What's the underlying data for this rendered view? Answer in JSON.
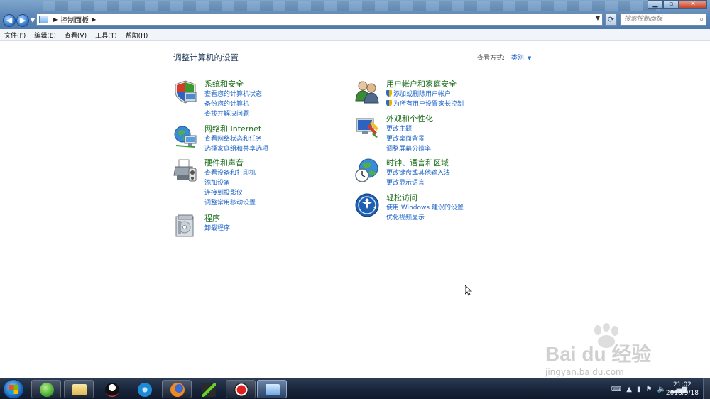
{
  "window": {
    "address": {
      "crumb": "控制面板"
    },
    "search_placeholder": "搜索控制面板",
    "controls": {
      "minimize": "▁",
      "maximize": "▫",
      "close": "✕"
    }
  },
  "menubar": [
    {
      "label": "文件(F)"
    },
    {
      "label": "编辑(E)"
    },
    {
      "label": "查看(V)"
    },
    {
      "label": "工具(T)"
    },
    {
      "label": "帮助(H)"
    }
  ],
  "content": {
    "title": "调整计算机的设置",
    "viewby": {
      "label": "查看方式:",
      "value": "类别"
    },
    "left_categories": [
      {
        "heading": "系统和安全",
        "icon": "shield-icon",
        "links": [
          "查看您的计算机状态",
          "备份您的计算机",
          "查找并解决问题"
        ]
      },
      {
        "heading": "网络和 Internet",
        "icon": "network-icon",
        "links": [
          "查看网络状态和任务",
          "选择家庭组和共享选项"
        ]
      },
      {
        "heading": "硬件和声音",
        "icon": "printer-icon",
        "links": [
          "查看设备和打印机",
          "添加设备",
          "连接到投影仪",
          "调整常用移动设置"
        ]
      },
      {
        "heading": "程序",
        "icon": "programs-icon",
        "links": [
          "卸载程序"
        ]
      }
    ],
    "right_categories": [
      {
        "heading": "用户帐户和家庭安全",
        "icon": "users-icon",
        "links": [
          "添加或删除用户帐户",
          "为所有用户设置家长控制"
        ],
        "shielded": true
      },
      {
        "heading": "外观和个性化",
        "icon": "appearance-icon",
        "links": [
          "更改主题",
          "更改桌面背景",
          "调整屏幕分辨率"
        ]
      },
      {
        "heading": "时钟、语言和区域",
        "icon": "globe-clock-icon",
        "links": [
          "更改键盘或其他输入法",
          "更改显示语言"
        ]
      },
      {
        "heading": "轻松访问",
        "icon": "ease-of-access-icon",
        "links": [
          "使用 Windows 建议的设置",
          "优化视频显示"
        ]
      }
    ]
  },
  "watermark": {
    "brand": "Bai du 经验",
    "url": "jingyan.baidu.com"
  },
  "taskbar": {
    "apps": [
      "app-green-icon",
      "file-explorer-icon",
      "qq-icon",
      "video-app-icon",
      "firefox-icon",
      "media-player-icon",
      "record-icon",
      "control-panel-icon"
    ],
    "clock": {
      "time": "21:02",
      "date": "2018/9/18"
    }
  }
}
